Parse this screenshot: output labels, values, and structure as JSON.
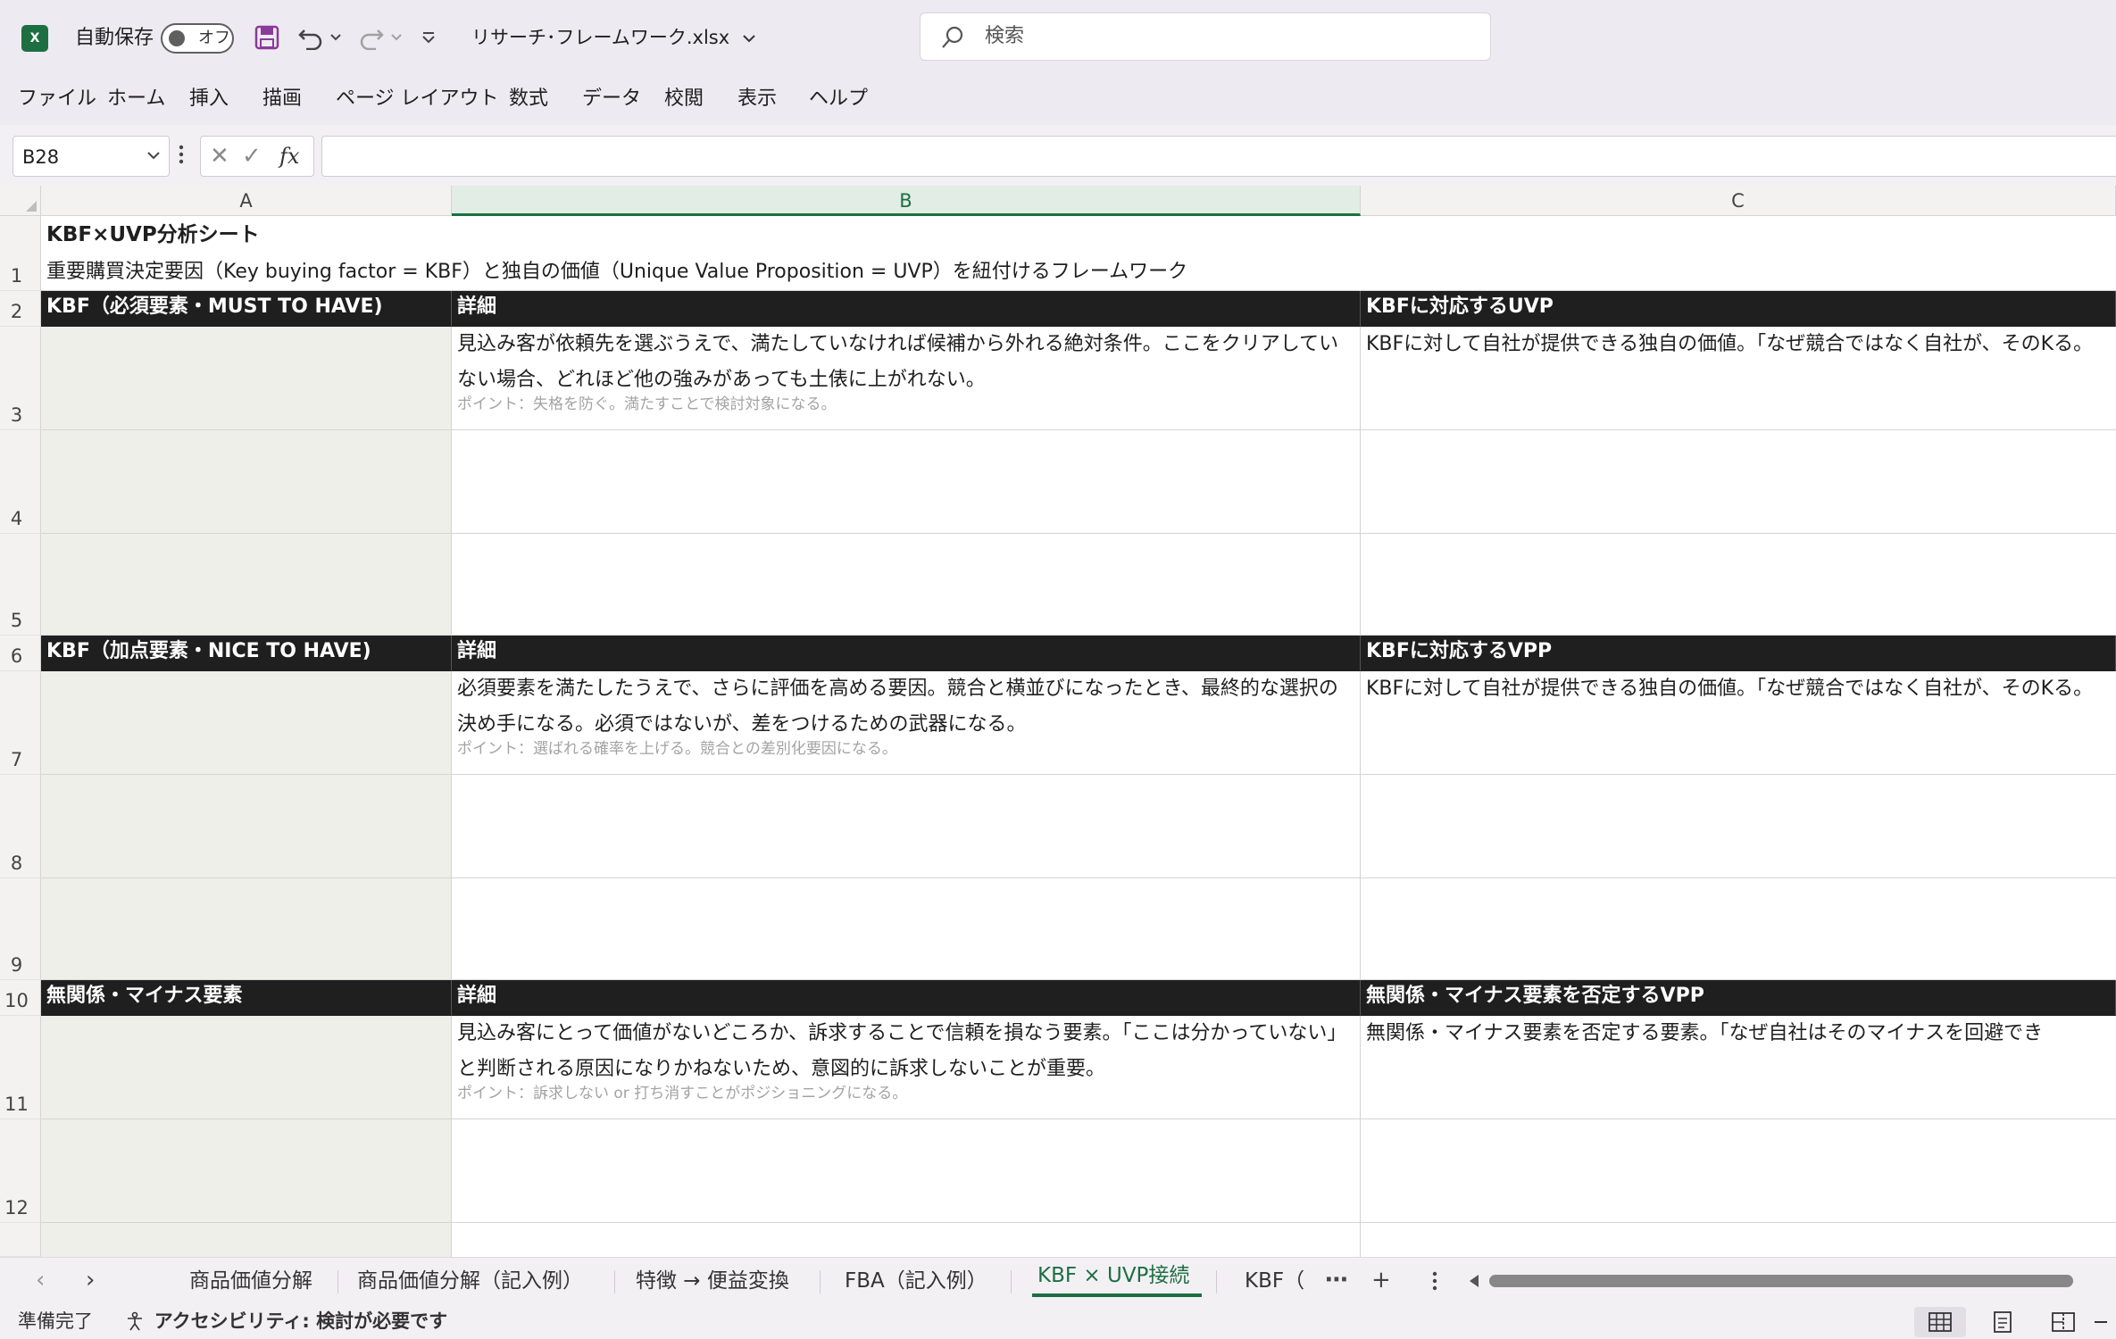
{
  "titlebar": {
    "app_icon": "X",
    "autosave_label": "自動保存",
    "autosave_state": "オフ",
    "filename": "リサーチ･フレームワーク.xlsx",
    "search_placeholder": "検索"
  },
  "menu": [
    "ファイル",
    "ホーム",
    "挿入",
    "描画",
    "ページ レイアウト",
    "数式",
    "データ",
    "校閲",
    "表示",
    "ヘルプ"
  ],
  "formula_bar": {
    "name_box": "B28",
    "fx_label": "fx",
    "formula": ""
  },
  "columns": [
    "A",
    "B",
    "C"
  ],
  "rows": [
    "1",
    "2",
    "3",
    "4",
    "5",
    "6",
    "7",
    "8",
    "9",
    "10",
    "11",
    "12"
  ],
  "sheet": {
    "title": "KBF×UVP分析シート",
    "subtitle": "重要購買決定要因（Key buying factor = KBF）と独自の価値（Unique Value Proposition = UVP）を紐付けるフレームワーク",
    "sections": [
      {
        "header_a": "KBF（必須要素・MUST TO HAVE)",
        "header_b": "詳細",
        "header_c": "KBFに対応するUVP",
        "detail": "見込み客が依頼先を選ぶうえで、満たしていなければ候補から外れる絶対条件。ここをクリアしていない場合、どれほど他の強みがあっても土俵に上がれない。",
        "note": "ポイント：失格を防ぐ。満たすことで検討対象になる。",
        "c_text": "KBFに対して自社が提供できる独自の価値。「なぜ競合ではなく自社が、そのKる。"
      },
      {
        "header_a": "KBF（加点要素・NICE TO HAVE)",
        "header_b": "詳細",
        "header_c": "KBFに対応するVPP",
        "detail": "必須要素を満たしたうえで、さらに評価を高める要因。競合と横並びになったとき、最終的な選択の決め手になる。必須ではないが、差をつけるための武器になる。",
        "note": "ポイント：選ばれる確率を上げる。競合との差別化要因になる。",
        "c_text": "KBFに対して自社が提供できる独自の価値。「なぜ競合ではなく自社が、そのKる。"
      },
      {
        "header_a": "無関係・マイナス要素",
        "header_b": "詳細",
        "header_c": "無関係・マイナス要素を否定するVPP",
        "detail": "見込み客にとって価値がないどころか、訴求することで信頼を損なう要素。「ここは分かっていない」と判断される原因になりかねないため、意図的に訴求しないことが重要。",
        "note": "ポイント：訴求しない or 打ち消すことがポジショニングになる。",
        "c_text": "無関係・マイナス要素を否定する要素。「なぜ自社はそのマイナスを回避でき"
      }
    ]
  },
  "tabs": [
    "商品価値分解",
    "商品価値分解（記入例）",
    "特徴 → 便益変換",
    "FBA（記入例）",
    "KBF × UVP接続",
    "KBF（"
  ],
  "active_tab": "KBF × UVP接続",
  "status": {
    "ready": "準備完了",
    "accessibility": "アクセシビリティ: 検討が必要です"
  },
  "colors": {
    "accent": "#1d6f42",
    "header_dark": "#1f1f1f",
    "shade": "#efefe9"
  },
  "icons": [
    "excel-logo-icon",
    "save-icon",
    "undo-icon",
    "redo-icon",
    "customize-icon",
    "search-icon",
    "chevron-down-icon",
    "cancel-icon",
    "enter-icon",
    "fx-icon",
    "more-icon",
    "add-sheet-icon",
    "normal-view-icon",
    "page-layout-icon",
    "page-break-icon"
  ]
}
